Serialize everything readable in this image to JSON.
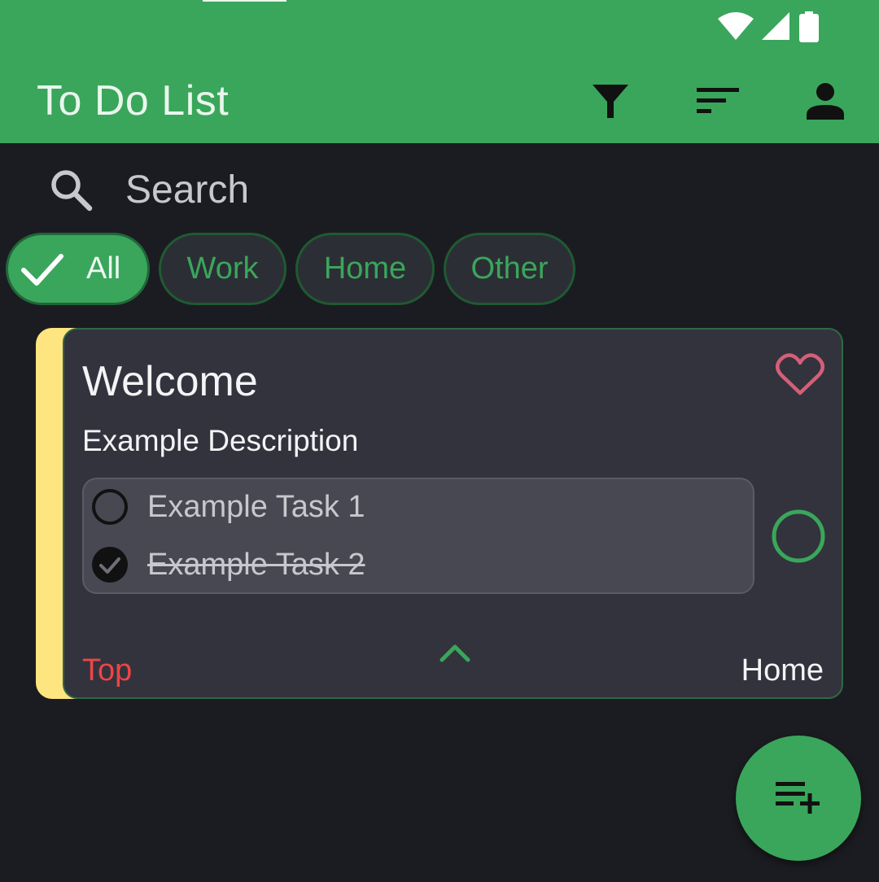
{
  "appbar": {
    "title": "To Do List",
    "actions": [
      {
        "name": "filter",
        "icon": "filter-icon"
      },
      {
        "name": "sort",
        "icon": "sort-icon"
      },
      {
        "name": "account",
        "icon": "person-icon"
      }
    ]
  },
  "status_bar": {
    "icons": [
      "wifi-icon",
      "signal-icon",
      "battery-icon"
    ]
  },
  "search": {
    "placeholder": "Search"
  },
  "chips": [
    {
      "label": "All",
      "selected": true
    },
    {
      "label": "Work",
      "selected": false
    },
    {
      "label": "Home",
      "selected": false
    },
    {
      "label": "Other",
      "selected": false
    }
  ],
  "card": {
    "title": "Welcome",
    "description": "Example Description",
    "tasks": [
      {
        "label": "Example Task 1",
        "done": false
      },
      {
        "label": "Example Task 2",
        "done": true
      }
    ],
    "priority": "Top",
    "category": "Home",
    "favorite": false
  },
  "colors": {
    "primary": "#3aa65b",
    "background": "#1b1c21",
    "card": "#32333d",
    "stripe": "#ffe57f",
    "priority": "#ef4444",
    "favorite": "#d45f78"
  },
  "fab": {
    "icon": "playlist-add-icon"
  }
}
